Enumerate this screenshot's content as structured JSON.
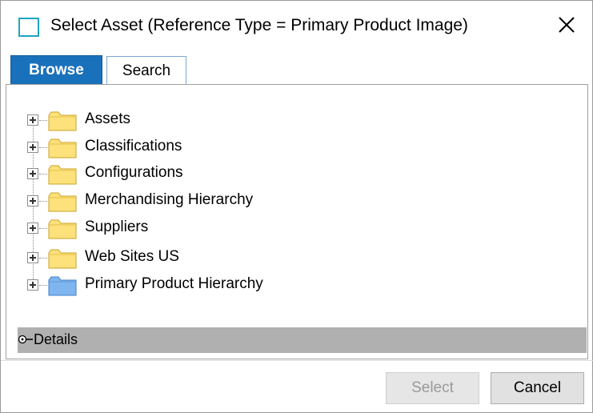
{
  "dialog": {
    "title": "Select Asset (Reference Type = Primary Product Image)"
  },
  "tabs": [
    {
      "label": "Browse",
      "active": true
    },
    {
      "label": "Search",
      "active": false
    }
  ],
  "tree": {
    "items": [
      {
        "label": "Assets",
        "icon": "folder-yellow-icon"
      },
      {
        "label": "Classifications",
        "icon": "folder-yellow-icon"
      },
      {
        "label": "Configurations",
        "icon": "folder-yellow-icon"
      },
      {
        "label": "Merchandising Hierarchy",
        "icon": "folder-yellow-icon"
      },
      {
        "label": "Suppliers",
        "icon": "folder-yellow-icon"
      },
      {
        "label": "Web Sites US",
        "icon": "folder-yellow-icon"
      },
      {
        "label": "Primary Product Hierarchy",
        "icon": "folder-blue-icon"
      }
    ]
  },
  "details": {
    "label": "Details"
  },
  "buttons": {
    "select_label": "Select",
    "select_enabled": false,
    "cancel_label": "Cancel"
  },
  "colors": {
    "accent": "#1a71bb",
    "folder_yellow": "#fde17a",
    "folder_blue": "#7fb6f0",
    "details_bar": "#b0b0b0"
  }
}
